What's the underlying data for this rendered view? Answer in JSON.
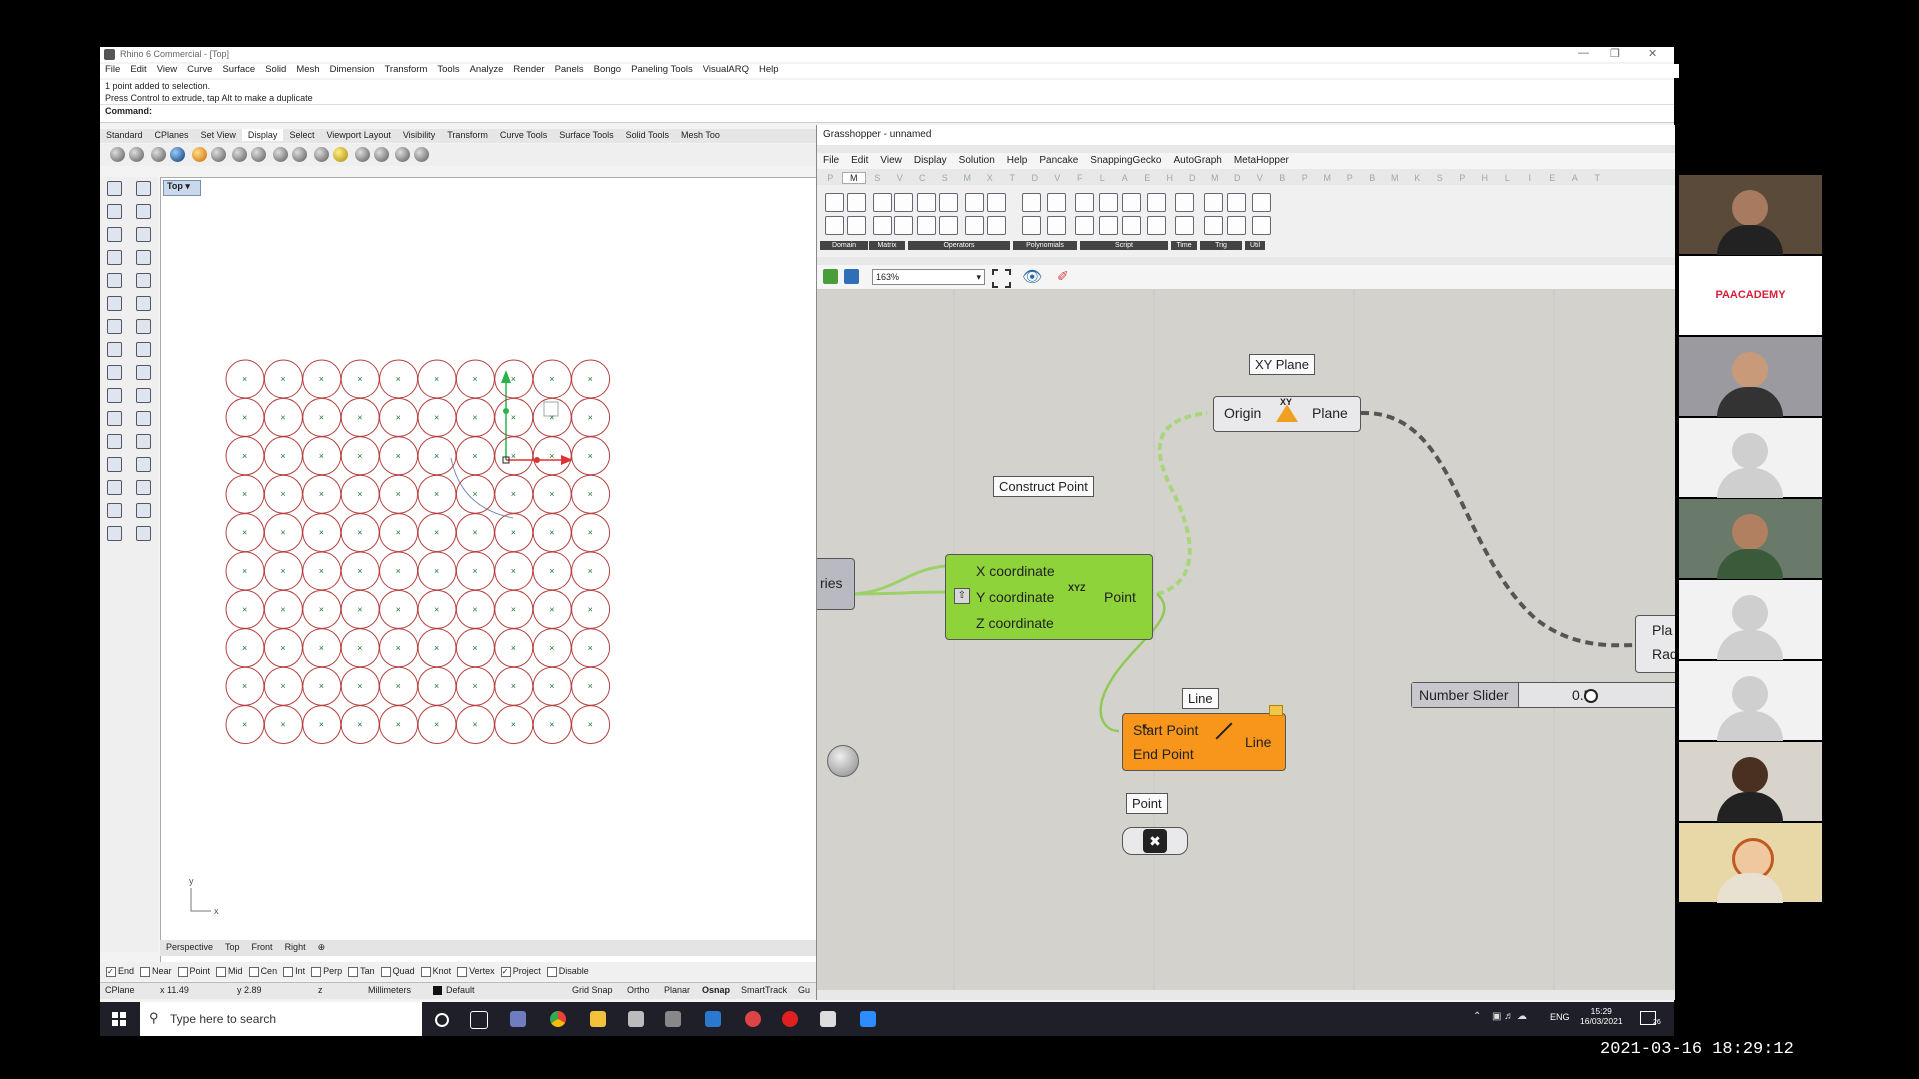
{
  "rhino": {
    "title": "Rhino 6 Commercial - [Top]",
    "menu": [
      "File",
      "Edit",
      "View",
      "Curve",
      "Surface",
      "Solid",
      "Mesh",
      "Dimension",
      "Transform",
      "Tools",
      "Analyze",
      "Render",
      "Panels",
      "Bongo",
      "Paneling Tools",
      "VisualARQ",
      "Help"
    ],
    "history": [
      "1 point added to selection.",
      "Press Control to extrude, tap Alt to make a duplicate"
    ],
    "command_label": "Command:",
    "tabs": [
      "Standard",
      "CPlanes",
      "Set View",
      "Display",
      "Select",
      "Viewport Layout",
      "Visibility",
      "Transform",
      "Curve Tools",
      "Surface Tools",
      "Solid Tools",
      "Mesh Too"
    ],
    "active_tab": "Display",
    "viewport_title": "Top",
    "viewport_tabs": [
      "Perspective",
      "Top",
      "Front",
      "Right"
    ],
    "grid": {
      "rows": 10,
      "cols": 10
    },
    "axis_labels": {
      "y": "y",
      "x": "x"
    },
    "osnaps": [
      {
        "label": "End",
        "on": true
      },
      {
        "label": "Near",
        "on": false
      },
      {
        "label": "Point",
        "on": false
      },
      {
        "label": "Mid",
        "on": false
      },
      {
        "label": "Cen",
        "on": false
      },
      {
        "label": "Int",
        "on": false
      },
      {
        "label": "Perp",
        "on": false
      },
      {
        "label": "Tan",
        "on": false
      },
      {
        "label": "Quad",
        "on": false
      },
      {
        "label": "Knot",
        "on": false
      },
      {
        "label": "Vertex",
        "on": false
      },
      {
        "label": "Project",
        "on": true
      },
      {
        "label": "Disable",
        "on": false
      }
    ],
    "status": {
      "cplane": "CPlane",
      "x": "x 11.49",
      "y": "y 2.89",
      "z": "z",
      "units": "Millimeters",
      "layer": "Default",
      "grid_snap": "Grid Snap",
      "ortho": "Ortho",
      "planar": "Planar",
      "osnap": "Osnap",
      "smarttrack": "SmartTrack",
      "gumball": "Gu"
    }
  },
  "grasshopper": {
    "title": "Grasshopper - unnamed",
    "menu": [
      "File",
      "Edit",
      "View",
      "Display",
      "Solution",
      "Help",
      "Pancake",
      "SnappingGecko",
      "AutoGraph",
      "MetaHopper"
    ],
    "letters": [
      "P",
      "M",
      "S",
      "V",
      "C",
      "S",
      "M",
      "X",
      "T",
      "D",
      "V",
      "F",
      "L",
      "A",
      "E",
      "H",
      "D",
      "M",
      "D",
      "V",
      "B",
      "P",
      "M",
      "P",
      "B",
      "M",
      "K",
      "S",
      "P",
      "H",
      "L",
      "I",
      "E",
      "A",
      "T"
    ],
    "active_letter_index": 1,
    "sections": [
      "Domain",
      "Matrix",
      "Operators",
      "Polynomials",
      "Script",
      "Time",
      "Trig",
      "Util"
    ],
    "zoom": "163%",
    "components": {
      "xy_plane": {
        "label": "XY Plane",
        "in": "Origin",
        "out": "Plane",
        "icon": "XY"
      },
      "construct_point": {
        "label": "Construct Point",
        "in": [
          "X coordinate",
          "Y coordinate",
          "Z coordinate"
        ],
        "out": "Point",
        "icon": "XYZ"
      },
      "series_partial": "ries",
      "line": {
        "label": "Line",
        "in": [
          "Start Point",
          "End Point"
        ],
        "out": "Line"
      },
      "point": {
        "label": "Point"
      },
      "number_slider": {
        "label": "Number Slider",
        "value": "0.5",
        "fraction": 0.35
      },
      "circle_partial": [
        "Pla",
        "Radi"
      ]
    }
  },
  "taskbar": {
    "search_placeholder": "Type here to search",
    "lang": "ENG",
    "time": "15:29",
    "date": "16/03/2021",
    "notif": "26"
  },
  "participants": {
    "brand": "PAACADEMY"
  },
  "recording_timestamp": "2021-03-16  18:29:12",
  "colors": {
    "gh_green": "#8fd33a",
    "gh_orange": "#f7961b",
    "circle_red": "#b4413f",
    "wire_green": "#9cd167"
  }
}
